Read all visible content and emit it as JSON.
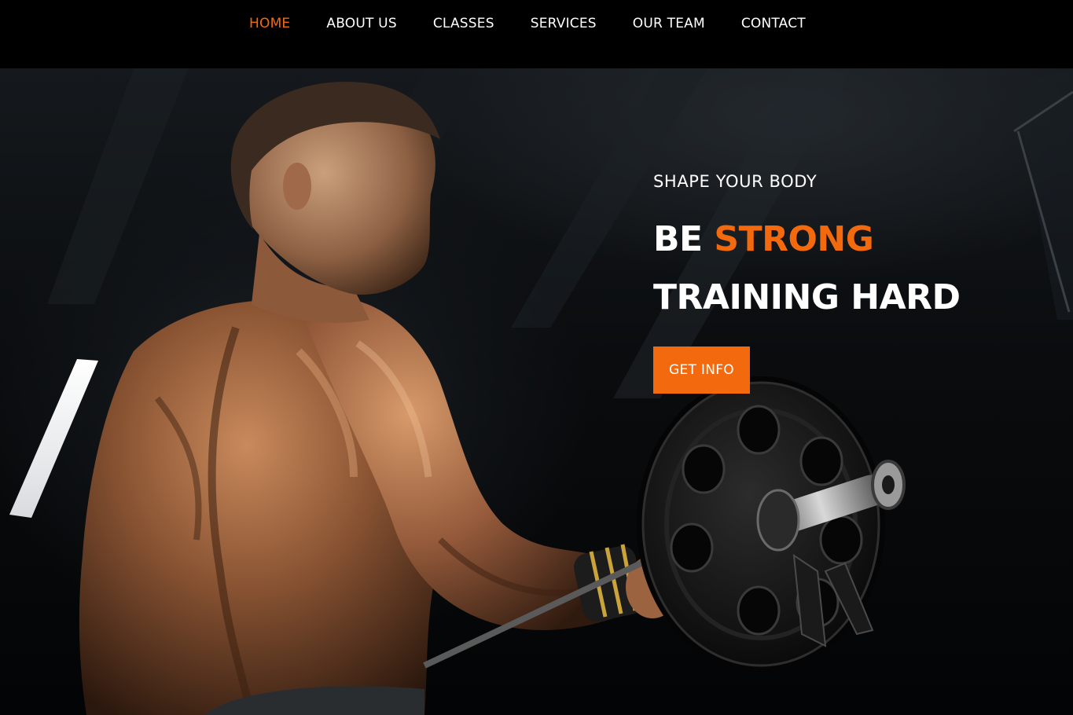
{
  "nav": {
    "items": [
      {
        "label": "HOME",
        "active": true
      },
      {
        "label": "ABOUT US",
        "active": false
      },
      {
        "label": "CLASSES",
        "active": false
      },
      {
        "label": "SERVICES",
        "active": false
      },
      {
        "label": "OUR TEAM",
        "active": false
      },
      {
        "label": "CONTACT",
        "active": false
      }
    ]
  },
  "hero": {
    "eyebrow": "SHAPE YOUR BODY",
    "headline_line1_prefix": "BE",
    "headline_line1_accent": "STRONG",
    "headline_line2": "TRAINING HARD",
    "cta_label": "GET INFO",
    "image": "bodybuilder-with-barbell-photo"
  },
  "colors": {
    "accent": "#f26a0d",
    "nav_background": "#000000",
    "text": "#ffffff"
  }
}
